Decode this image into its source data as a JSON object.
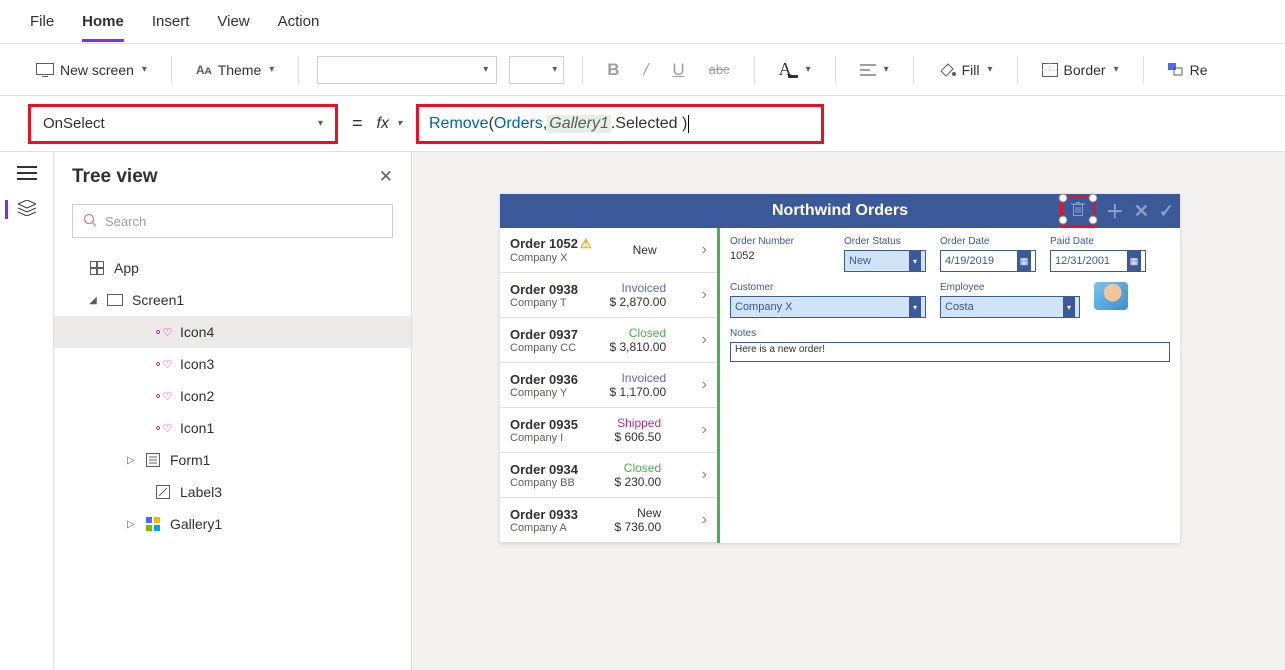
{
  "menu": {
    "file": "File",
    "home": "Home",
    "insert": "Insert",
    "view": "View",
    "action": "Action"
  },
  "ribbon": {
    "newscreen": "New screen",
    "theme": "Theme",
    "fill": "Fill",
    "border": "Border",
    "reorder": "Re"
  },
  "formula": {
    "property": "OnSelect",
    "eq": "=",
    "fx": "fx",
    "parts": {
      "fn": "Remove",
      "open": "( ",
      "arg1": "Orders",
      "comma": ", ",
      "arg2": "Gallery1",
      "suffix": ".Selected )"
    }
  },
  "panel": {
    "title": "Tree view",
    "search_ph": "Search"
  },
  "tree": {
    "app": "App",
    "screen": "Screen1",
    "icon4": "Icon4",
    "icon3": "Icon3",
    "icon2": "Icon2",
    "icon1": "Icon1",
    "form1": "Form1",
    "label3": "Label3",
    "gallery1": "Gallery1"
  },
  "app": {
    "title": "Northwind Orders",
    "orders": [
      {
        "id": "Order 1052",
        "company": "Company X",
        "status": "New",
        "statusCls": "status-new",
        "amount": "",
        "warn": true
      },
      {
        "id": "Order 0938",
        "company": "Company T",
        "status": "Invoiced",
        "statusCls": "status-inv",
        "amount": "$ 2,870.00"
      },
      {
        "id": "Order 0937",
        "company": "Company CC",
        "status": "Closed",
        "statusCls": "status-closed",
        "amount": "$ 3,810.00"
      },
      {
        "id": "Order 0936",
        "company": "Company Y",
        "status": "Invoiced",
        "statusCls": "status-inv",
        "amount": "$ 1,170.00"
      },
      {
        "id": "Order 0935",
        "company": "Company I",
        "status": "Shipped",
        "statusCls": "status-ship",
        "amount": "$ 606.50"
      },
      {
        "id": "Order 0934",
        "company": "Company BB",
        "status": "Closed",
        "statusCls": "status-closed",
        "amount": "$ 230.00"
      },
      {
        "id": "Order 0933",
        "company": "Company A",
        "status": "New",
        "statusCls": "status-new",
        "amount": "$ 736.00"
      }
    ],
    "detail": {
      "orderNumLbl": "Order Number",
      "orderNum": "1052",
      "orderStatusLbl": "Order Status",
      "orderStatus": "New",
      "orderDateLbl": "Order Date",
      "orderDate": "4/19/2019",
      "paidDateLbl": "Paid Date",
      "paidDate": "12/31/2001",
      "customerLbl": "Customer",
      "customer": "Company X",
      "employeeLbl": "Employee",
      "employee": "Costa",
      "notesLbl": "Notes",
      "notes": "Here is a new order!"
    }
  }
}
